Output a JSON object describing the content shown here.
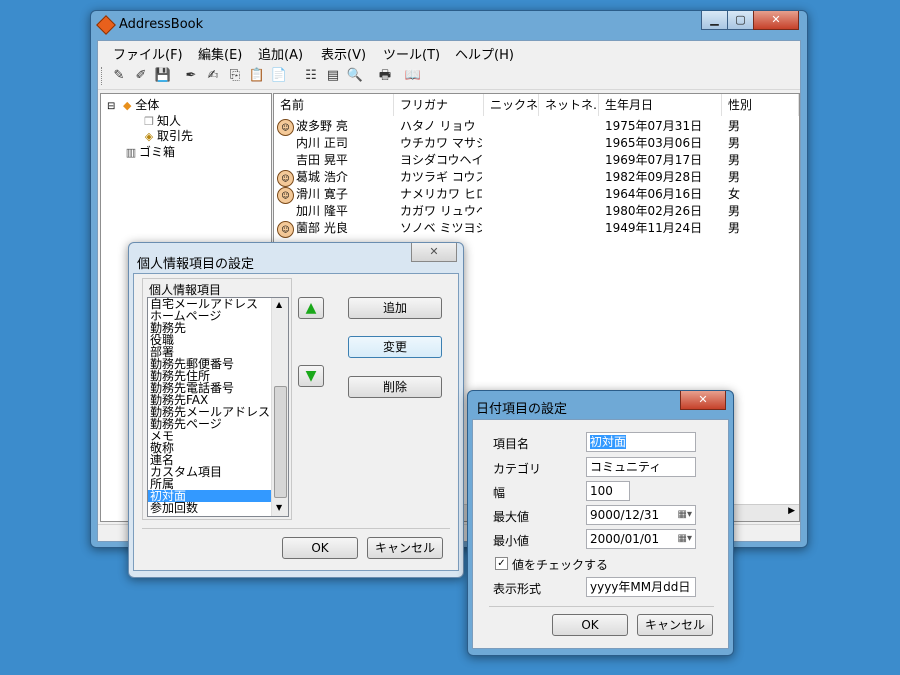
{
  "main_window": {
    "title": "AddressBook",
    "caption_min": "▁",
    "caption_max": "▢",
    "caption_close": "✕"
  },
  "menu": {
    "file": "ファイル(F)",
    "edit": "編集(E)",
    "add": "追加(A)",
    "view": "表示(V)",
    "tools": "ツール(T)",
    "help": "ヘルプ(H)"
  },
  "toolbar": {
    "icons": [
      "✎",
      "✐",
      "💾",
      "✒",
      "✍",
      "⎘",
      "📋",
      "📄",
      "☷",
      "▤",
      "🔍",
      "🖶",
      "📖"
    ]
  },
  "tree": {
    "root": "全体",
    "child1": "知人",
    "child2": "取引先",
    "trash": "ゴミ箱",
    "expander": "⊟"
  },
  "list": {
    "columns": [
      "名前",
      "フリガナ",
      "ニックネ…",
      "ネットネ…",
      "生年月日",
      "性別"
    ],
    "rows": [
      {
        "name": "波多野 亮",
        "kana": "ハタノ リョウ",
        "birth": "1975年07月31日",
        "sex": "男",
        "avatar": true
      },
      {
        "name": "内川 正司",
        "kana": "ウチカワ マサシ",
        "birth": "1965年03月06日",
        "sex": "男",
        "avatar": false
      },
      {
        "name": "吉田 晃平",
        "kana": "ヨシダコウヘイ",
        "birth": "1969年07月17日",
        "sex": "男",
        "avatar": false
      },
      {
        "name": "葛城 浩介",
        "kana": "カツラギ コウス…",
        "birth": "1982年09月28日",
        "sex": "男",
        "avatar": true
      },
      {
        "name": "滑川 寛子",
        "kana": "ナメリカワ ヒロコ",
        "birth": "1964年06月16日",
        "sex": "女",
        "avatar": true
      },
      {
        "name": "加川 隆平",
        "kana": "カガワ リュウヘイ",
        "birth": "1980年02月26日",
        "sex": "男",
        "avatar": false
      },
      {
        "name": "薗部 光良",
        "kana": "ソノベ ミツヨシ",
        "birth": "1949年11月24日",
        "sex": "男",
        "avatar": true
      }
    ]
  },
  "dialog_personal": {
    "title": "個人情報項目の設定",
    "close": "✕",
    "group_label": "個人情報項目",
    "items": [
      "自宅メールアドレス",
      "ホームページ",
      "勤務先",
      "役職",
      "部署",
      "勤務先郵便番号",
      "勤務先住所",
      "勤務先電話番号",
      "勤務先FAX",
      "勤務先メールアドレス",
      "勤務先ページ",
      "メモ",
      "敬称",
      "連名",
      "カスタム項目",
      "所属",
      "初対面",
      "参加回数"
    ],
    "selected_index": 16,
    "up": "▲",
    "down": "▼",
    "add": "追加",
    "change": "変更",
    "delete": "削除",
    "ok": "OK",
    "cancel": "キャンセル"
  },
  "dialog_date": {
    "title": "日付項目の設定",
    "close": "✕",
    "label_name": "項目名",
    "value_name": "初対面",
    "label_category": "カテゴリ",
    "value_category": "コミュニティ",
    "label_width": "幅",
    "value_width": "100",
    "label_max": "最大値",
    "value_max": "9000/12/31",
    "label_min": "最小値",
    "value_min": "2000/01/01",
    "check_label": "値をチェックする",
    "label_format": "表示形式",
    "value_format": "yyyy年MM月dd日",
    "ok": "OK",
    "cancel": "キャンセル"
  }
}
